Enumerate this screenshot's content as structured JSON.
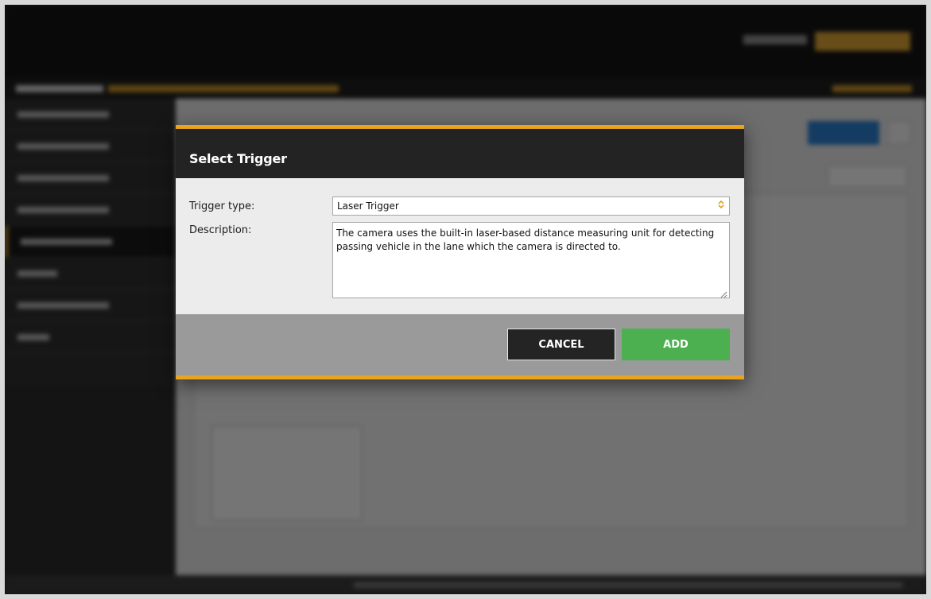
{
  "dialog": {
    "title": "Select Trigger",
    "trigger_type_label": "Trigger type:",
    "trigger_type_value": "Laser Trigger",
    "description_label": "Description:",
    "description_text": "The camera uses the built-in laser-based distance measuring unit for detecting passing vehicle in the lane which the camera is directed to.",
    "cancel_label": "CANCEL",
    "add_label": "ADD"
  },
  "colors": {
    "accent": "#e8a41f",
    "add_button": "#4cb050",
    "cancel_button": "#242424",
    "header": "#232323"
  },
  "icons": {
    "select_arrow": "up-down-chevron-icon",
    "resize": "resize-grip-icon"
  }
}
